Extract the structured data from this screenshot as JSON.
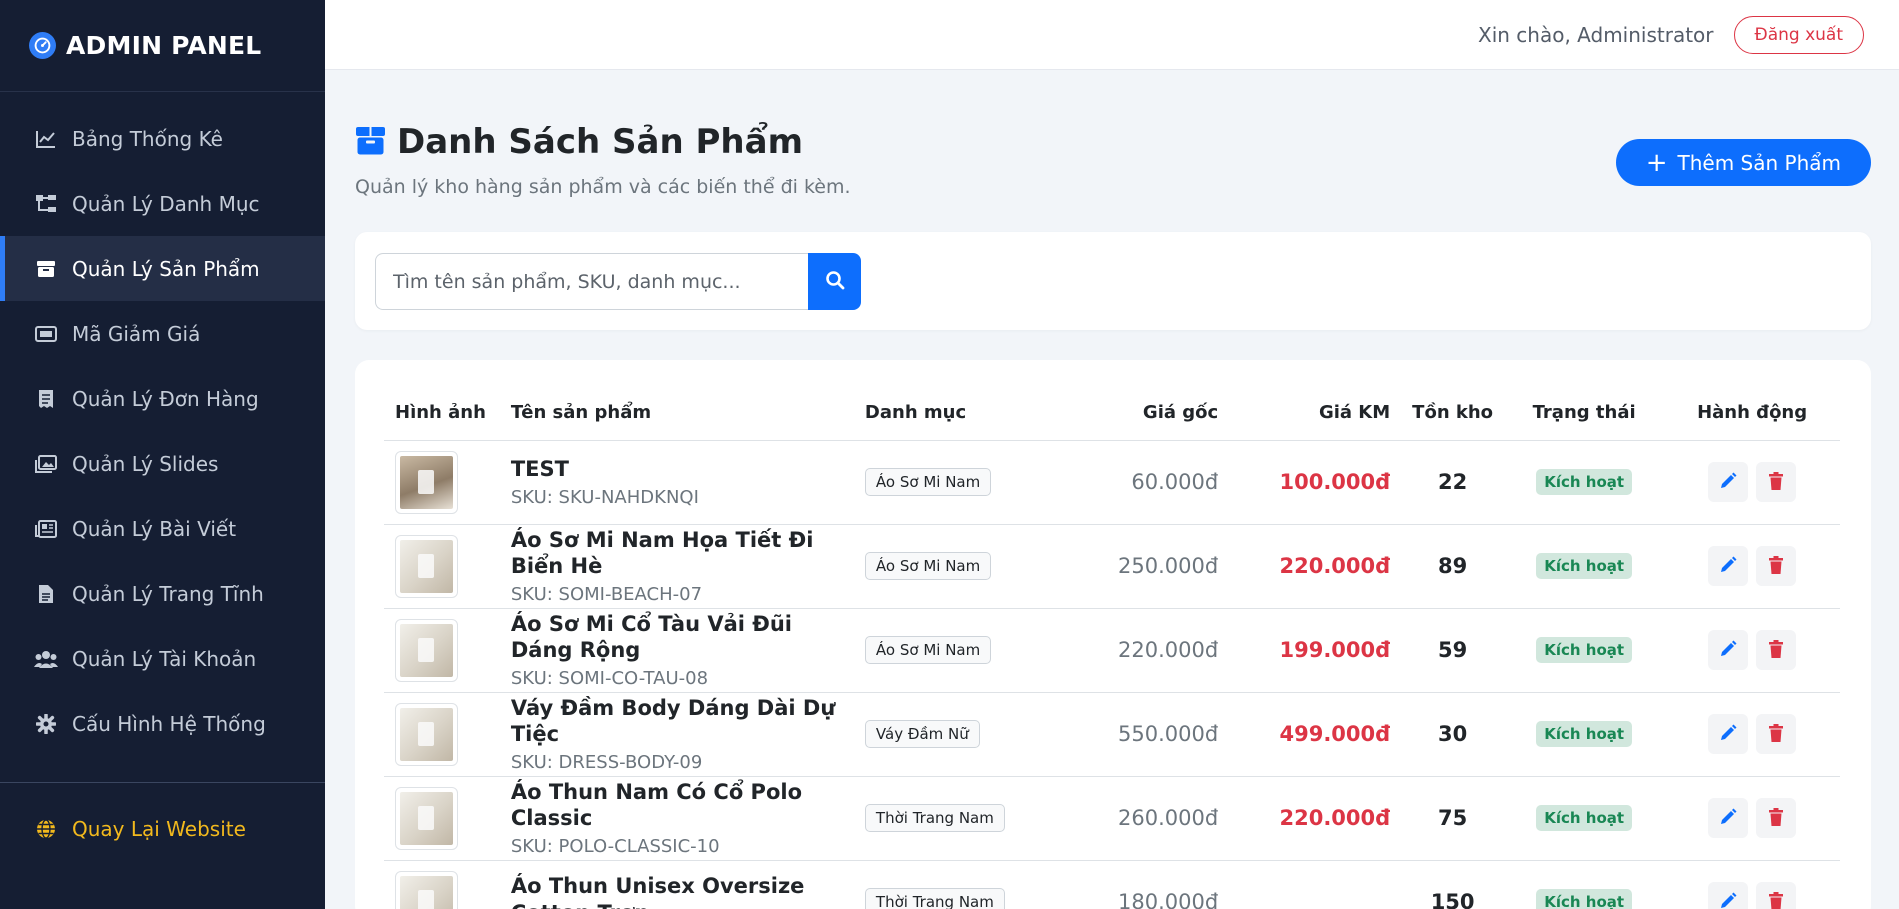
{
  "brand": {
    "title": "ADMIN PANEL"
  },
  "sidebar": {
    "items": [
      {
        "label": "Bảng Thống Kê",
        "icon": "chart-line-icon",
        "active": false
      },
      {
        "label": "Quản Lý Danh Mục",
        "icon": "sitemap-icon",
        "active": false
      },
      {
        "label": "Quản Lý Sản Phẩm",
        "icon": "box-icon",
        "active": true
      },
      {
        "label": "Mã Giảm Giá",
        "icon": "ticket-icon",
        "active": false
      },
      {
        "label": "Quản Lý Đơn Hàng",
        "icon": "receipt-icon",
        "active": false
      },
      {
        "label": "Quản Lý Slides",
        "icon": "images-icon",
        "active": false
      },
      {
        "label": "Quản Lý Bài Viết",
        "icon": "newspaper-icon",
        "active": false
      },
      {
        "label": "Quản Lý Trang Tĩnh",
        "icon": "file-icon",
        "active": false
      },
      {
        "label": "Quản Lý Tài Khoản",
        "icon": "users-icon",
        "active": false
      },
      {
        "label": "Cấu Hình Hệ Thống",
        "icon": "gear-icon",
        "active": false
      }
    ],
    "back_link": "Quay Lại Website"
  },
  "topbar": {
    "greeting": "Xin chào, Administrator",
    "logout_label": "Đăng xuất"
  },
  "page": {
    "title": "Danh Sách Sản Phẩm",
    "subtitle": "Quản lý kho hàng sản phẩm và các biến thể đi kèm.",
    "add_button": "Thêm Sản Phẩm"
  },
  "search": {
    "placeholder": "Tìm tên sản phẩm, SKU, danh mục..."
  },
  "table": {
    "headers": {
      "image": "Hình ảnh",
      "name": "Tên sản phẩm",
      "category": "Danh mục",
      "price": "Giá gốc",
      "sale_price": "Giá KM",
      "stock": "Tồn kho",
      "status": "Trạng thái",
      "actions": "Hành động"
    },
    "rows": [
      {
        "name": "TEST",
        "sku": "SKU: SKU-NAHDKNQI",
        "category": "Áo Sơ Mi Nam",
        "price": "60.000đ",
        "sale_price": "100.000đ",
        "stock": "22",
        "status": "Kích hoạt"
      },
      {
        "name": "Áo Sơ Mi Nam Họa Tiết Đi Biển Hè",
        "sku": "SKU: SOMI-BEACH-07",
        "category": "Áo Sơ Mi Nam",
        "price": "250.000đ",
        "sale_price": "220.000đ",
        "stock": "89",
        "status": "Kích hoạt"
      },
      {
        "name": "Áo Sơ Mi Cổ Tàu Vải Đũi Dáng Rộng",
        "sku": "SKU: SOMI-CO-TAU-08",
        "category": "Áo Sơ Mi Nam",
        "price": "220.000đ",
        "sale_price": "199.000đ",
        "stock": "59",
        "status": "Kích hoạt"
      },
      {
        "name": "Váy Đầm Body Dáng Dài Dự Tiệc",
        "sku": "SKU: DRESS-BODY-09",
        "category": "Váy Đầm Nữ",
        "price": "550.000đ",
        "sale_price": "499.000đ",
        "stock": "30",
        "status": "Kích hoạt"
      },
      {
        "name": "Áo Thun Nam Có Cổ Polo Classic",
        "sku": "SKU: POLO-CLASSIC-10",
        "category": "Thời Trang Nam",
        "price": "260.000đ",
        "sale_price": "220.000đ",
        "stock": "75",
        "status": "Kích hoạt"
      },
      {
        "name": "Áo Thun Unisex Oversize Cotton Trơn",
        "sku": "",
        "category": "Thời Trang Nam",
        "price": "180.000đ",
        "sale_price": "",
        "stock": "150",
        "status": "Kích hoạt"
      }
    ]
  },
  "colors": {
    "sidebar_bg": "#151e33",
    "primary": "#0d6efd",
    "danger": "#dc3545",
    "success": "#198754",
    "back_link": "#f2b91d"
  }
}
